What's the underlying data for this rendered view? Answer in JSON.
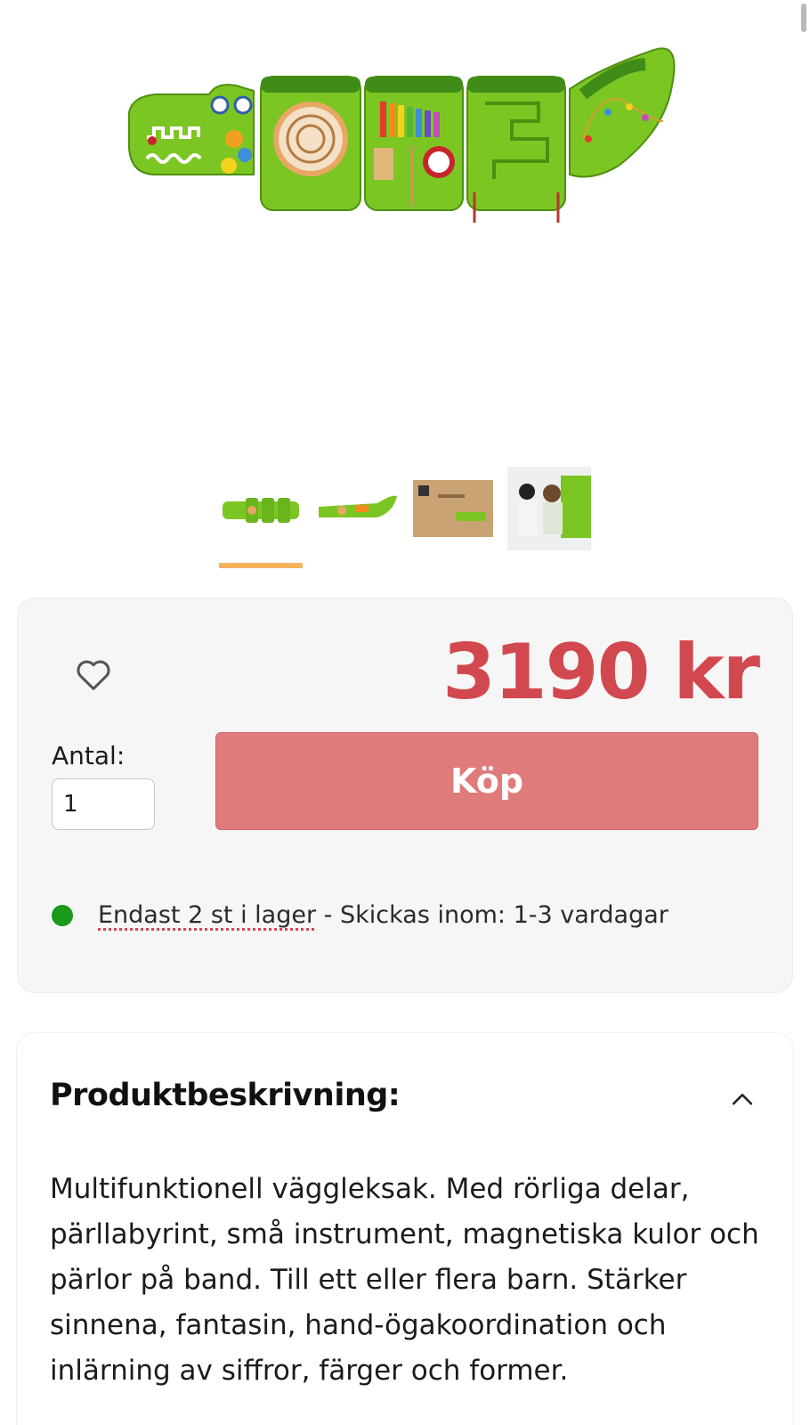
{
  "product": {
    "main_image_alt": "crocodile-activity-wall-toy",
    "thumbnails": [
      {
        "name": "thumb-crocodile-front",
        "active": true
      },
      {
        "name": "thumb-crocodile-side",
        "active": false
      },
      {
        "name": "thumb-box-packaging",
        "active": false
      },
      {
        "name": "thumb-children-playing",
        "active": false
      }
    ]
  },
  "purchase": {
    "price": "3190 kr",
    "quantity_label": "Antal:",
    "quantity_value": "1",
    "buy_label": "Köp",
    "stock_link": "Endast 2 st i lager",
    "stock_rest": " - Skickas inom: 1-3 vardagar",
    "favorite_icon": "heart-icon",
    "colors": {
      "price": "#d2484f",
      "buy_button": "#e07b7b",
      "stock_dot": "#1a9a1a",
      "thumb_indicator": "#f2b35a"
    }
  },
  "description": {
    "title": "Produktbeskrivning:",
    "toggle_icon": "chevron-up-icon",
    "text": "Multifunktionell väggleksak. Med rörliga delar, pärllabyrint, små instrument, magnetiska kulor och pärlor på band. Till ett eller flera barn. Stärker sinnena, fantasin, hand-ögakoordination och inlärning av siffror, färger och former."
  }
}
